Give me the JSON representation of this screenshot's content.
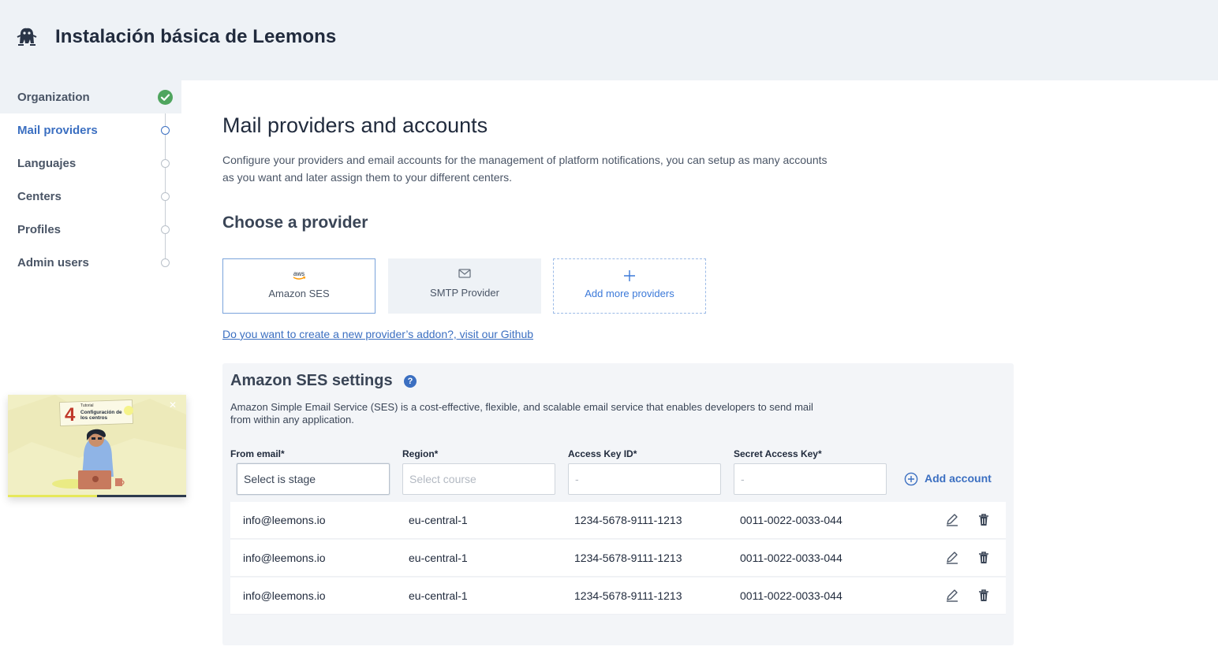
{
  "app": {
    "title": "Instalación básica de Leemons",
    "logo": "leemons-logo-icon"
  },
  "sidebar": {
    "items": [
      {
        "label": "Organization",
        "status": "done"
      },
      {
        "label": "Mail providers",
        "status": "active"
      },
      {
        "label": "Languajes",
        "status": "pending"
      },
      {
        "label": "Centers",
        "status": "pending"
      },
      {
        "label": "Profiles",
        "status": "pending"
      },
      {
        "label": "Admin users",
        "status": "pending"
      }
    ],
    "video": {
      "badge": "4",
      "tag": "Tutorial",
      "title": "Configuración de los centros",
      "progress": 0.5
    }
  },
  "main": {
    "title": "Mail providers and accounts",
    "description": "Configure your providers and email accounts for the management of platform notifications, you can setup as many accounts as you want and later assign them to your different centers.",
    "choose_title": "Choose a provider",
    "providers": [
      {
        "label": "Amazon SES",
        "icon": "aws-logo-icon",
        "selected": true
      },
      {
        "label": "SMTP Provider",
        "icon": "mail-icon",
        "selected": false
      },
      {
        "label": "Add more providers",
        "icon": "plus-icon",
        "selected": false
      }
    ],
    "github_link": "Do you want to create a new provider’s addon?, visit our Github"
  },
  "settings": {
    "title": "Amazon SES settings",
    "help_glyph": "?",
    "description": "Amazon Simple Email Service (SES) is a cost-effective, flexible, and scalable email service that enables developers to send mail from within any application.",
    "fields": [
      {
        "label": "From email*",
        "value": "Select is stage"
      },
      {
        "label": "Region*",
        "value": "Select course"
      },
      {
        "label": "Access Key ID*",
        "value": "-"
      },
      {
        "label": "Secret Access Key*",
        "value": "-"
      }
    ],
    "add_account_label": "Add account",
    "accounts": [
      {
        "email": "info@leemons.io",
        "region": "eu-central-1",
        "access_key": "1234-5678-9111-1213",
        "secret_key": "0011-0022-0033-044"
      },
      {
        "email": "info@leemons.io",
        "region": "eu-central-1",
        "access_key": "1234-5678-9111-1213",
        "secret_key": "0011-0022-0033-044"
      },
      {
        "email": "info@leemons.io",
        "region": "eu-central-1",
        "access_key": "1234-5678-9111-1213",
        "secret_key": "0011-0022-0033-044"
      }
    ]
  },
  "colors": {
    "accent": "#3b6fc1",
    "success": "#4fa55e",
    "header_bg": "#eef2f6",
    "panel_bg": "#f3f5f8"
  }
}
